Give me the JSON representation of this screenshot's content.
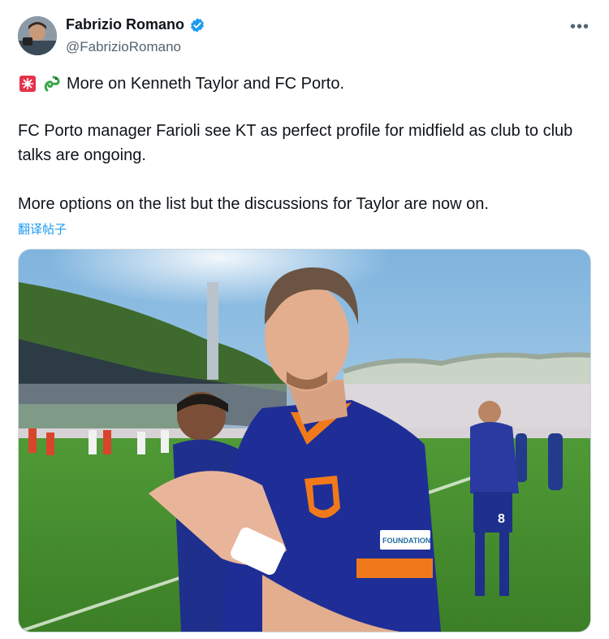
{
  "author": {
    "display_name": "Fabrizio Romano",
    "handle": "@FabrizioRomano",
    "verified_color": "#1d9bf0"
  },
  "tweet": {
    "line1": "More on Kenneth Taylor and FC Porto.",
    "line1_icons": [
      "siren-icon",
      "dragon-icon"
    ],
    "para2": "FC Porto manager Farioli see KT as perfect profile for midfield as club to club talks are ongoing.",
    "para3": "More options on the list but the discussions for Taylor are now on.",
    "translate_label": "翻译帖子"
  },
  "media": {
    "jersey_number": "8",
    "sleeve_patch": "FOUNDATION"
  },
  "colors": {
    "link": "#1d9bf0",
    "text": "#0f1419",
    "muted": "#536471",
    "jersey_blue": "#1f2f8c",
    "jersey_orange": "#f07a1a"
  }
}
